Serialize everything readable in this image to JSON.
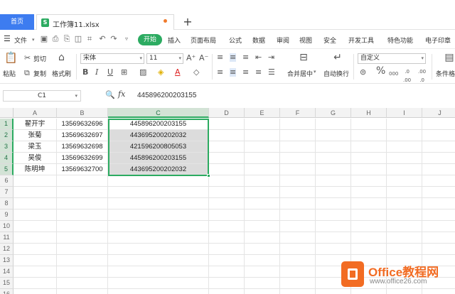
{
  "tabs": {
    "home": "首页",
    "file": "工作簿11.xlsx",
    "file_icon": "S",
    "new_tab": "+"
  },
  "menu": {
    "file": "文件",
    "start": "开始",
    "items": [
      "插入",
      "页面布局",
      "公式",
      "数据",
      "审阅",
      "视图",
      "安全",
      "开发工具",
      "特色功能",
      "电子印章"
    ]
  },
  "ribbon": {
    "paste": "粘贴",
    "cut": "剪切",
    "copy": "复制",
    "format_painter": "格式刷",
    "font_name": "宋体",
    "font_size": "11",
    "merge_center": "合并居中",
    "wrap_text": "自动换行",
    "number_format": "自定义",
    "conditional_format": "条件格",
    "percent": "%",
    "thousands": "000"
  },
  "formula_bar": {
    "name_box": "C1",
    "fx": "fx",
    "value": "445896200203155"
  },
  "grid": {
    "columns": [
      "A",
      "B",
      "C",
      "D",
      "E",
      "F",
      "G",
      "H",
      "I",
      "J"
    ],
    "rows": [
      "1",
      "2",
      "3",
      "4",
      "5",
      "6",
      "7",
      "8",
      "9",
      "10",
      "11",
      "12",
      "13",
      "14",
      "15",
      "16"
    ],
    "data": [
      [
        "翟开宇",
        "13569632696",
        "445896200203155"
      ],
      [
        "张菊",
        "13569632697",
        "443695200202032"
      ],
      [
        "梁玉",
        "13569632698",
        "421596200805053"
      ],
      [
        "吴俊",
        "13569632699",
        "445896200203155"
      ],
      [
        "陈明坤",
        "13569632700",
        "443695200202032"
      ]
    ]
  },
  "watermark": {
    "brand": "Office教程网",
    "url": "www.office26.com"
  },
  "colors": {
    "accent_green": "#2cab61",
    "tab_blue": "#3d7cf0",
    "watermark_orange": "#f26c23"
  }
}
